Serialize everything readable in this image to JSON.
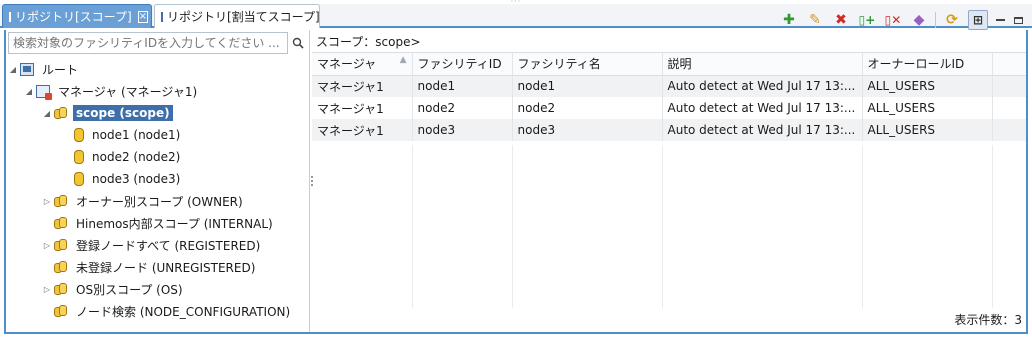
{
  "tabs": [
    {
      "label": "リポジトリ[スコープ]",
      "active": true
    },
    {
      "label": "リポジトリ[割当てスコープ]",
      "active": false
    }
  ],
  "toolbar": {
    "icons": [
      "add-icon",
      "edit-icon",
      "delete-icon",
      "assign-node-icon",
      "release-node-icon",
      "clear-icon",
      "refresh-icon",
      "tree-view-icon"
    ]
  },
  "search": {
    "placeholder": "検索対象のファシリティIDを入力してください ..."
  },
  "scope_path": "スコープ：scope>",
  "tree": {
    "root": "ルート",
    "manager": "マネージャ (マネージャ1)",
    "scope": "scope (scope)",
    "node1": "node1 (node1)",
    "node2": "node2 (node2)",
    "node3": "node3 (node3)",
    "owner": "オーナー別スコープ (OWNER)",
    "internal": "Hinemos内部スコープ (INTERNAL)",
    "registered": "登録ノードすべて (REGISTERED)",
    "unregistered": "未登録ノード (UNREGISTERED)",
    "os": "OS別スコープ (OS)",
    "node_config": "ノード検索 (NODE_CONFIGURATION)"
  },
  "table": {
    "headers": [
      "マネージャ",
      "ファシリティID",
      "ファシリティ名",
      "説明",
      "オーナーロールID"
    ],
    "rows": [
      [
        "マネージャ1",
        "node1",
        "node1",
        "Auto detect at Wed Jul 17 13:...",
        "ALL_USERS"
      ],
      [
        "マネージャ1",
        "node2",
        "node2",
        "Auto detect at Wed Jul 17 13:...",
        "ALL_USERS"
      ],
      [
        "マネージャ1",
        "node3",
        "node3",
        "Auto detect at Wed Jul 17 13:...",
        "ALL_USERS"
      ]
    ]
  },
  "count_label": "表示件数：3",
  "colors": {
    "accent": "#4f8fc9",
    "active_tab": "#6aa0d6",
    "selection": "#3f6fa8"
  }
}
